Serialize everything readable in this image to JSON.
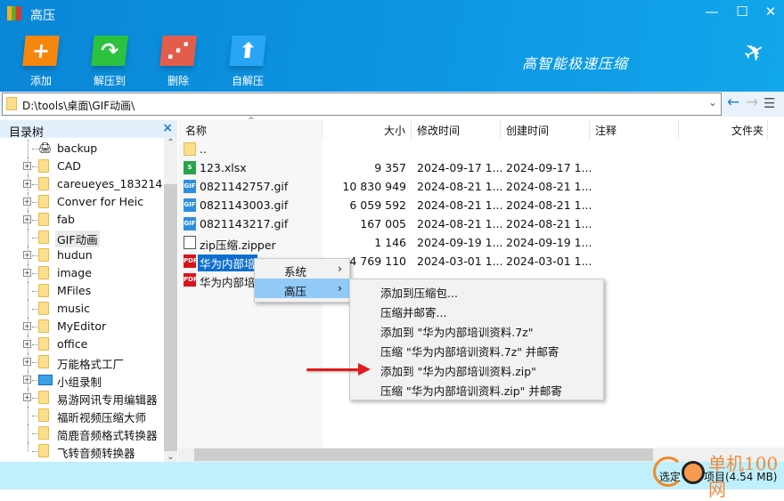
{
  "window": {
    "title": "高压",
    "slogan": "高智能极速压缩",
    "minimize": "—",
    "maximize": "☐",
    "close": "✕"
  },
  "toolbar": [
    {
      "label": "添加",
      "glyph": "+",
      "color": "#f7860d"
    },
    {
      "label": "解压到",
      "glyph": "↷",
      "color": "#2cc23f"
    },
    {
      "label": "删除",
      "glyph": "⋰",
      "color": "#e35d4d"
    },
    {
      "label": "自解压",
      "glyph": "⬆",
      "color": "#2aa4f4"
    }
  ],
  "address": {
    "path": "D:\\tools\\桌面\\GIF动画\\"
  },
  "sidebar": {
    "title": "目录树",
    "close": "×",
    "items": [
      {
        "label": "backup",
        "expand": false,
        "icon": "drive"
      },
      {
        "label": "CAD",
        "expand": true
      },
      {
        "label": "careueyes_183214",
        "expand": true
      },
      {
        "label": "Conver for Heic",
        "expand": true
      },
      {
        "label": "fab",
        "expand": true
      },
      {
        "label": "GIF动画",
        "expand": false,
        "selected": true
      },
      {
        "label": "hudun",
        "expand": true
      },
      {
        "label": "image",
        "expand": true
      },
      {
        "label": "MFiles",
        "expand": false
      },
      {
        "label": "music",
        "expand": false
      },
      {
        "label": "MyEditor",
        "expand": true
      },
      {
        "label": "office",
        "expand": true
      },
      {
        "label": "万能格式工厂",
        "expand": true
      },
      {
        "label": "小组录制",
        "expand": true,
        "icon": "monitor"
      },
      {
        "label": "易游网讯专用编辑器",
        "expand": true
      },
      {
        "label": "福昕视频压缩大师",
        "expand": false
      },
      {
        "label": "简鹿音频格式转换器",
        "expand": false
      },
      {
        "label": "飞转音频转换器",
        "expand": false
      }
    ]
  },
  "list": {
    "columns": [
      "名称",
      "大小",
      "修改时间",
      "创建时间",
      "注释",
      "文件夹"
    ],
    "rows": [
      {
        "name": "..",
        "size": "",
        "modified": "",
        "created": "",
        "type": "folder"
      },
      {
        "name": "123.xlsx",
        "size": "9 357",
        "modified": "2024-09-17 1...",
        "created": "2024-09-17 1...",
        "type": "xlsx"
      },
      {
        "name": "0821142757.gif",
        "size": "10 830 949",
        "modified": "2024-08-21 1...",
        "created": "2024-08-21 1...",
        "type": "gif"
      },
      {
        "name": "0821143003.gif",
        "size": "6 059 592",
        "modified": "2024-08-21 1...",
        "created": "2024-08-21 1...",
        "type": "gif"
      },
      {
        "name": "0821143217.gif",
        "size": "167 005",
        "modified": "2024-08-21 1...",
        "created": "2024-08-21 1...",
        "type": "gif"
      },
      {
        "name": "zip压缩.zipper",
        "size": "1 146",
        "modified": "2024-09-19 1...",
        "created": "2024-09-19 1...",
        "type": "zipper"
      },
      {
        "name": "华为内部培",
        "size": "4 769 110",
        "modified": "2024-03-01 1...",
        "created": "2024-03-01 1...",
        "type": "pdf",
        "selected": true
      },
      {
        "name": "华为内部培",
        "size": "",
        "modified": "",
        "created": "",
        "type": "pdf"
      }
    ]
  },
  "context_menu": {
    "items": [
      {
        "label": "系统"
      },
      {
        "label": "高压",
        "highlighted": true
      }
    ]
  },
  "submenu": {
    "items": [
      "添加到压缩包...",
      "压缩并邮寄...",
      "添加到 \"华为内部培训资料.7z\"",
      "压缩 \"华为内部培训资料.7z\" 并邮寄",
      "添加到 \"华为内部培训资料.zip\"",
      "压缩 \"华为内部培训资料.zip\" 并邮寄"
    ]
  },
  "status": {
    "left": "选定",
    "right": "项目(4.54 MB)"
  },
  "watermark": "单机100网"
}
